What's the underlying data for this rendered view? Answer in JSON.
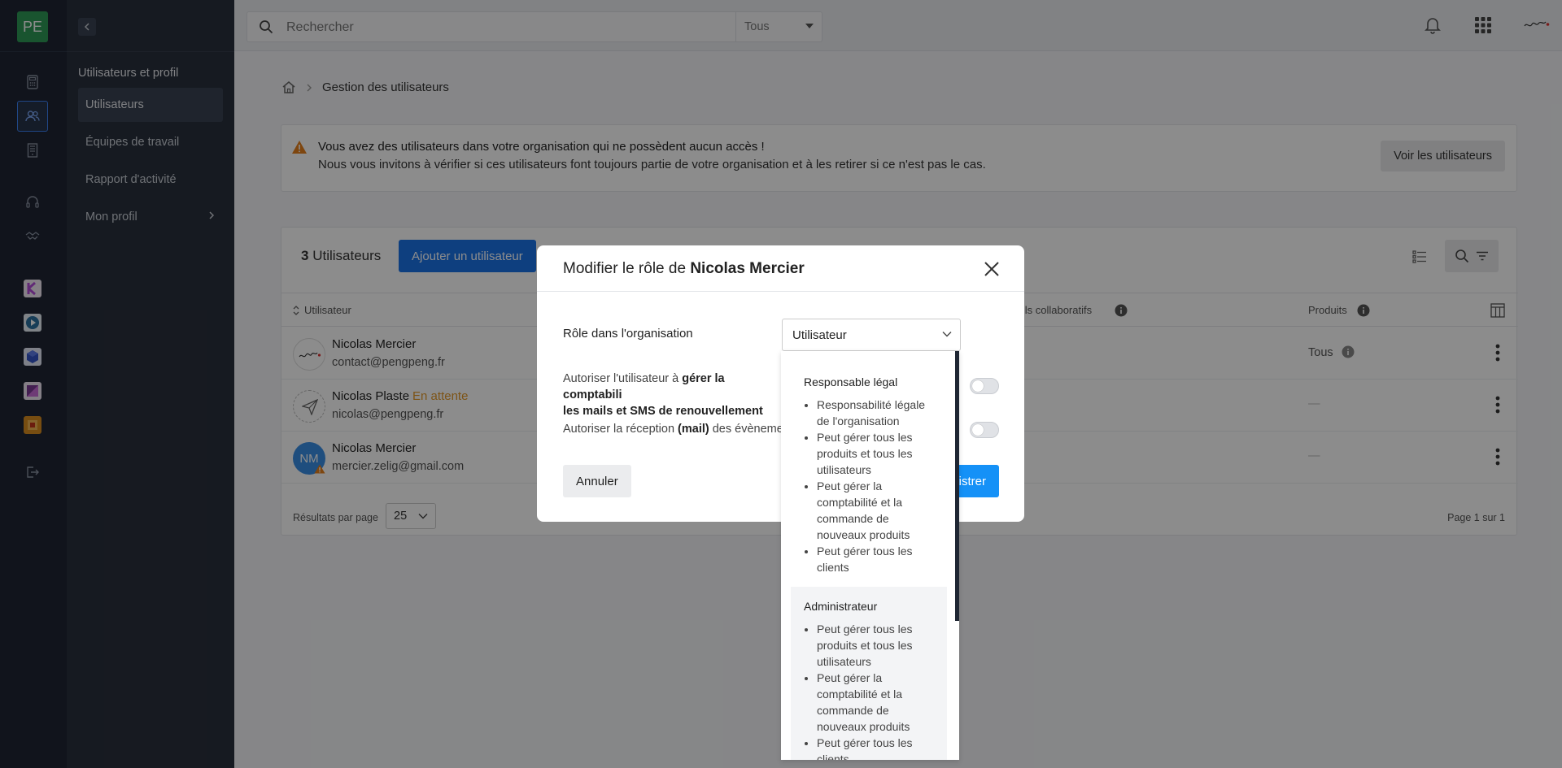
{
  "rail": {
    "logo": "PE"
  },
  "nav": {
    "section_title": "Utilisateurs et profil",
    "items": [
      {
        "label": "Utilisateurs"
      },
      {
        "label": "Équipes de travail"
      },
      {
        "label": "Rapport d'activité"
      },
      {
        "label": "Mon profil"
      }
    ]
  },
  "topbar": {
    "search_placeholder": "Rechercher",
    "scope": "Tous"
  },
  "breadcrumb": {
    "current": "Gestion des utilisateurs"
  },
  "alert": {
    "line1": "Vous avez des utilisateurs dans votre organisation qui ne possèdent aucun accès !",
    "line2": "Nous vous invitons à vérifier si ces utilisateurs font toujours partie de votre organisation et à les retirer si ce n'est pas le cas.",
    "button": "Voir les utilisateurs"
  },
  "users_panel": {
    "count": "3",
    "count_label": "Utilisateurs",
    "add_button": "Ajouter un utilisateur",
    "columns": {
      "user": "Utilisateur",
      "tools": "utils collaboratifs",
      "products": "Produits"
    },
    "rows": [
      {
        "name": "Nicolas Mercier",
        "email": "contact@pengpeng.fr",
        "status": "",
        "products": "Tous"
      },
      {
        "name": "Nicolas Plaste",
        "email": "nicolas@pengpeng.fr",
        "status": "En attente",
        "products": "—"
      },
      {
        "name": "Nicolas Mercier",
        "email": "mercier.zelig@gmail.com",
        "status": "",
        "products": "—",
        "initials": "NM"
      }
    ],
    "per_page_label": "Résultats par page",
    "per_page": "25",
    "pagination": "Page 1 sur 1"
  },
  "modal": {
    "title_prefix": "Modifier le rôle de",
    "title_name": "Nicolas Mercier",
    "role_label": "Rôle dans l'organisation",
    "role_value": "Utilisateur",
    "perm1_a": "Autoriser l'utilisateur à ",
    "perm1_b": "gérer la comptabili",
    "perm1_c": "les mails et SMS de renouvellement",
    "perm2_a": "Autoriser la réception ",
    "perm2_b": "(mail)",
    "perm2_c": " des évènemen",
    "cancel": "Annuler",
    "save": "istrer"
  },
  "dropdown": {
    "options": [
      {
        "title": "Responsable légal",
        "bullets": [
          "Responsabilité légale de l'organisation",
          "Peut gérer tous les produits et tous les utilisateurs",
          "Peut gérer la comptabilité et la commande de nouveaux produits",
          "Peut gérer tous les clients"
        ]
      },
      {
        "title": "Administrateur",
        "bullets": [
          "Peut gérer tous les produits et tous les utilisateurs",
          "Peut gérer la comptabilité et la commande de nouveaux produits",
          "Peut gérer tous les clients"
        ]
      }
    ]
  },
  "colors": {
    "primary": "#1a73e8",
    "save": "#1591f7",
    "pending": "#e39a2a",
    "rail": "#1f2633",
    "sidebar": "#29303d",
    "logo": "#2f9a57"
  }
}
